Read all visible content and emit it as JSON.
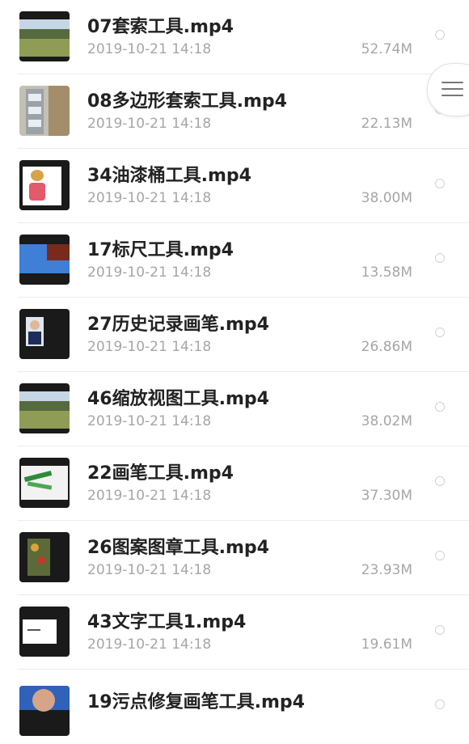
{
  "files": [
    {
      "name": "07套索工具.mp4",
      "date": "2019-10-21 14:18",
      "size": "52.74M",
      "thumb_icon": "landscape-thumbnail"
    },
    {
      "name": "08多边形套索工具.mp4",
      "date": "2019-10-21 14:18",
      "size": "22.13M",
      "thumb_icon": "building-thumbnail"
    },
    {
      "name": "34油漆桶工具.mp4",
      "date": "2019-10-21 14:18",
      "size": "38.00M",
      "thumb_icon": "cartoon-girl-thumbnail"
    },
    {
      "name": "17标尺工具.mp4",
      "date": "2019-10-21 14:18",
      "size": "13.58M",
      "thumb_icon": "sky-thumbnail"
    },
    {
      "name": "27历史记录画笔.mp4",
      "date": "2019-10-21 14:18",
      "size": "26.86M",
      "thumb_icon": "portrait-thumbnail"
    },
    {
      "name": "46缩放视图工具.mp4",
      "date": "2019-10-21 14:18",
      "size": "38.02M",
      "thumb_icon": "landscape-thumbnail"
    },
    {
      "name": "22画笔工具.mp4",
      "date": "2019-10-21 14:18",
      "size": "37.30M",
      "thumb_icon": "brush-thumbnail"
    },
    {
      "name": "26图案图章工具.mp4",
      "date": "2019-10-21 14:18",
      "size": "23.93M",
      "thumb_icon": "fruit-thumbnail"
    },
    {
      "name": "43文字工具1.mp4",
      "date": "2019-10-21 14:18",
      "size": "19.61M",
      "thumb_icon": "text-thumbnail"
    },
    {
      "name": "19污点修复画笔工具.mp4",
      "date": "",
      "size": "",
      "thumb_icon": "face-thumbnail"
    }
  ],
  "menu_button": {
    "icon": "hamburger-menu-icon"
  },
  "colors": {
    "text": "#222222",
    "secondary": "#a6a6a6",
    "divider": "#ececec",
    "background": "#ffffff"
  }
}
